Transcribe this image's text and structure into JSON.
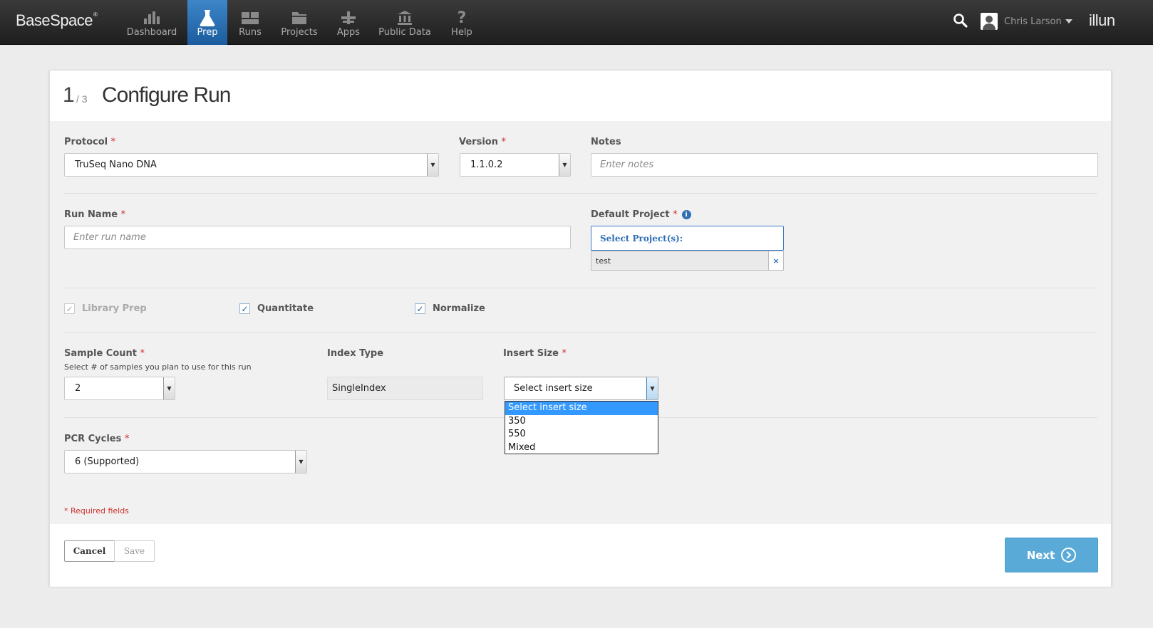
{
  "header": {
    "logo": "BaseSpace",
    "logo_mark": "®",
    "nav": [
      {
        "label": "Dashboard",
        "icon": "dashboard-icon"
      },
      {
        "label": "Prep",
        "icon": "flask-icon",
        "active": true
      },
      {
        "label": "Runs",
        "icon": "runs-icon"
      },
      {
        "label": "Projects",
        "icon": "folder-icon"
      },
      {
        "label": "Apps",
        "icon": "apps-icon"
      },
      {
        "label": "Public Data",
        "icon": "bank-icon"
      },
      {
        "label": "Help",
        "icon": "help-icon"
      }
    ],
    "user_name": "Chris Larson",
    "brand": "illun"
  },
  "page": {
    "step": "1",
    "step_total": "/ 3",
    "title": "Configure Run"
  },
  "form": {
    "protocol_label": "Protocol",
    "protocol_value": "TruSeq Nano DNA",
    "version_label": "Version",
    "version_value": "1.1.0.2",
    "notes_label": "Notes",
    "notes_placeholder": "Enter notes",
    "run_name_label": "Run Name",
    "run_name_placeholder": "Enter run name",
    "default_project_label": "Default Project",
    "select_projects": "Select Project(s):",
    "project_chip": "test",
    "library_prep_label": "Library Prep",
    "quantitate_label": "Quantitate",
    "normalize_label": "Normalize",
    "sample_count_label": "Sample Count",
    "sample_count_sub": "Select # of samples you plan to use for this run",
    "sample_count_value": "2",
    "index_type_label": "Index Type",
    "index_type_value": "SingleIndex",
    "insert_size_label": "Insert Size",
    "insert_size_value": "Select insert size",
    "insert_size_options": [
      "Select insert size",
      "350",
      "550",
      "Mixed"
    ],
    "pcr_cycles_label": "PCR Cycles",
    "pcr_cycles_value": "6 (Supported)",
    "required_note": "* Required fields",
    "req_mark": "*"
  },
  "footer": {
    "cancel": "Cancel",
    "save": "Save",
    "next": "Next"
  },
  "colors": {
    "accent": "#5aaad8",
    "nav_active": "#2a72b5",
    "required": "#c9302c"
  }
}
